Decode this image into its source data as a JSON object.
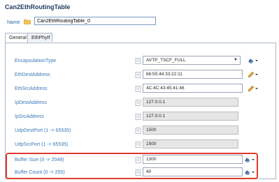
{
  "header": {
    "title": "Can2EthRoutingTable"
  },
  "name_row": {
    "label": "Name",
    "value": "Can2EthRoutingTable_0"
  },
  "tabs": [
    {
      "label": "General",
      "active": true
    },
    {
      "label": "EthPhyIf",
      "active": false
    }
  ],
  "rows": [
    {
      "label": "EncapsulationType",
      "value": "AVTP_TSCF_FULL",
      "kind": "dropdown",
      "action_icon": "value-source-icon"
    },
    {
      "label": "EthDestAddress",
      "value": "66:55:44:33:22:11",
      "kind": "editable",
      "action_icon": "pencil-edit-icon"
    },
    {
      "label": "EthSrcAddress",
      "value": "4C:4C:43:45:41:46",
      "kind": "editable",
      "action_icon": "pencil-edit-icon"
    },
    {
      "label": "IpDestAddress",
      "value": "127.0.0.1",
      "kind": "readonly"
    },
    {
      "label": "IpSrcAddress",
      "value": "127.0.0.1",
      "kind": "readonly"
    },
    {
      "label": "UdpDestPort (1 -> 65535)",
      "value": "1500",
      "kind": "readonly"
    },
    {
      "label": "UdpSrcPort (1 -> 65535)",
      "value": "1500",
      "kind": "readonly"
    },
    {
      "label": "Buffer Size (0 -> 2048)",
      "value": "1300",
      "kind": "editable",
      "action_icon": "value-source-icon"
    },
    {
      "label": "Buffer Count (0 -> 255)",
      "value": "40",
      "kind": "editable",
      "action_icon": "value-source-icon"
    }
  ],
  "colors": {
    "highlight": "#e0392f",
    "label": "#3a78b9",
    "title": "#233a62"
  }
}
